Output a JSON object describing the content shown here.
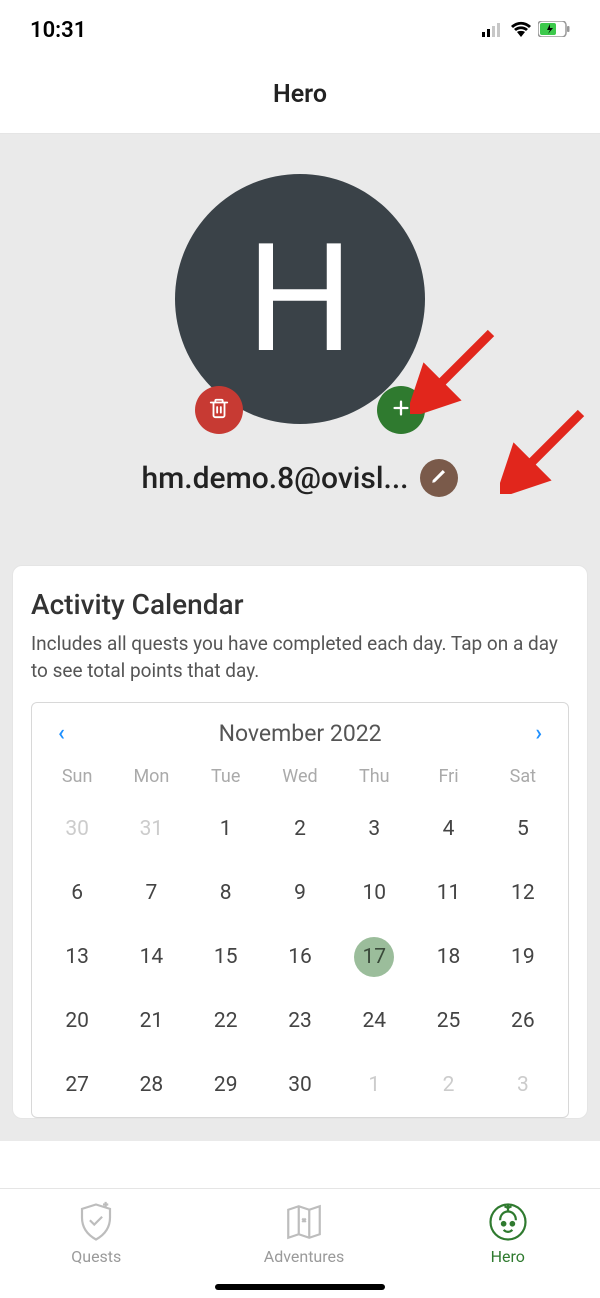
{
  "status": {
    "time": "10:31"
  },
  "header": {
    "title": "Hero"
  },
  "profile": {
    "avatar_letter": "H",
    "username": "hm.demo.8@ovisl..."
  },
  "calendar": {
    "title": "Activity Calendar",
    "description": "Includes all quests you have completed each day. Tap on a day to see total points that day.",
    "month_label": "November 2022",
    "dow": [
      "Sun",
      "Mon",
      "Tue",
      "Wed",
      "Thu",
      "Fri",
      "Sat"
    ],
    "days": [
      {
        "n": "30",
        "other": true
      },
      {
        "n": "31",
        "other": true
      },
      {
        "n": "1"
      },
      {
        "n": "2"
      },
      {
        "n": "3"
      },
      {
        "n": "4"
      },
      {
        "n": "5"
      },
      {
        "n": "6"
      },
      {
        "n": "7"
      },
      {
        "n": "8"
      },
      {
        "n": "9"
      },
      {
        "n": "10"
      },
      {
        "n": "11"
      },
      {
        "n": "12"
      },
      {
        "n": "13"
      },
      {
        "n": "14"
      },
      {
        "n": "15"
      },
      {
        "n": "16"
      },
      {
        "n": "17",
        "today": true
      },
      {
        "n": "18"
      },
      {
        "n": "19"
      },
      {
        "n": "20"
      },
      {
        "n": "21"
      },
      {
        "n": "22"
      },
      {
        "n": "23"
      },
      {
        "n": "24"
      },
      {
        "n": "25"
      },
      {
        "n": "26"
      },
      {
        "n": "27"
      },
      {
        "n": "28"
      },
      {
        "n": "29"
      },
      {
        "n": "30"
      },
      {
        "n": "1",
        "other": true
      },
      {
        "n": "2",
        "other": true
      },
      {
        "n": "3",
        "other": true
      }
    ]
  },
  "nav": {
    "items": [
      {
        "id": "quests",
        "label": "Quests",
        "active": false
      },
      {
        "id": "adventures",
        "label": "Adventures",
        "active": false
      },
      {
        "id": "hero",
        "label": "Hero",
        "active": true
      }
    ]
  }
}
